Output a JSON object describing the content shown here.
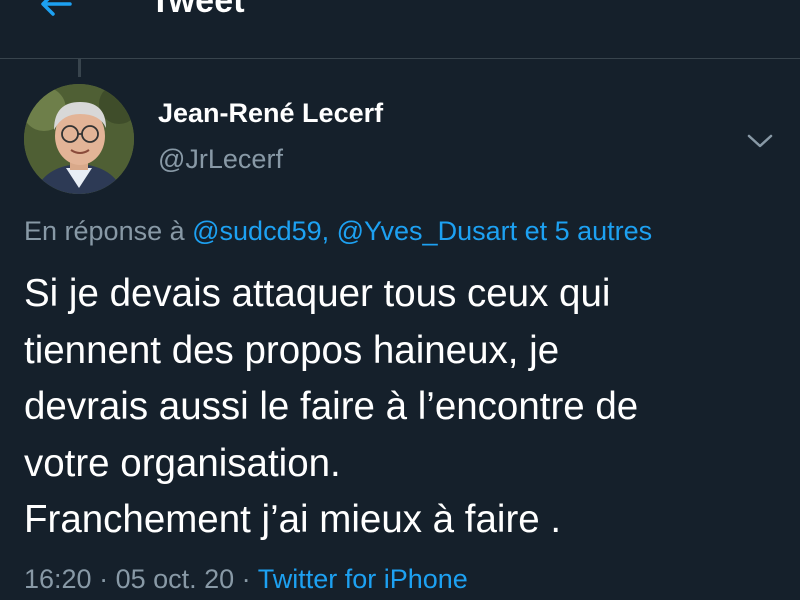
{
  "header": {
    "title": "Tweet",
    "back_icon": "arrow-left-icon"
  },
  "tweet": {
    "author": {
      "name": "Jean-René Lecerf",
      "handle": "@JrLecerf"
    },
    "reply": {
      "prefix": "En réponse à ",
      "mentions": "@sudcd59, @Yves_Dusart et 5 autres"
    },
    "text_lines": [
      "Si je devais attaquer tous ceux qui",
      "tiennent des propos haineux, je",
      "devrais aussi le faire à l’encontre de",
      "votre organisation.",
      "Franchement j’ai mieux à faire ."
    ],
    "time": "16:20",
    "separator_1": " · ",
    "date": "05 oct. 20",
    "separator_2": " · ",
    "source": "Twitter for iPhone"
  },
  "colors": {
    "background": "#15202b",
    "accent": "#1da1f2",
    "secondary_text": "#8899a6",
    "divider": "#38444d"
  }
}
